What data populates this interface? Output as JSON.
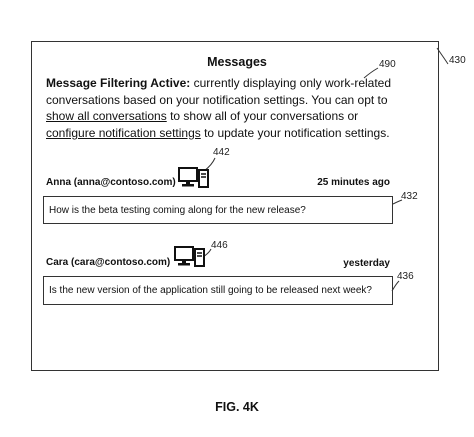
{
  "diagram": {
    "ref_outer": "430",
    "ref_notice": "490",
    "panel": {
      "title": "Messages",
      "notice": {
        "bold": "Message Filtering Active:",
        "part1": " currently displaying only work-related conversations based on your notification settings.  You can opt to ",
        "link1": "show all conversations",
        "part2": " to show all of your conversations or ",
        "link2": "configure notification settings",
        "part3": " to update your notification settings."
      },
      "messages": [
        {
          "sender": "Anna  (anna@contoso.com)",
          "time": "25 minutes ago",
          "text": "How is the beta testing coming along for the new release?",
          "device_ref": "442",
          "box_ref": "432",
          "device_icon": "desktop-computer-icon"
        },
        {
          "sender": "Cara  (cara@contoso.com)",
          "time": "yesterday",
          "text": "Is the new version of the application still going to be released next week?",
          "device_ref": "446",
          "box_ref": "436",
          "device_icon": "desktop-computer-icon"
        }
      ]
    },
    "figure_label": "FIG. 4K"
  }
}
